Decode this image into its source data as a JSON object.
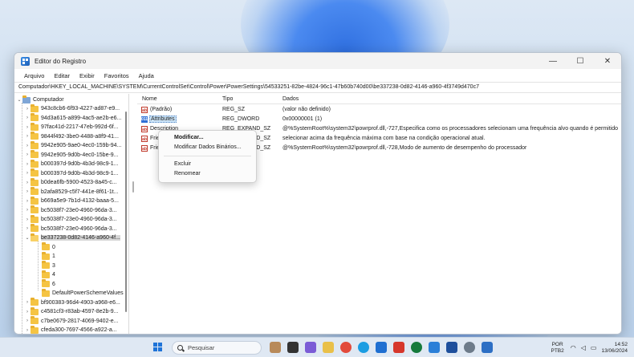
{
  "window": {
    "title": "Editor do Registro",
    "controls": {
      "minimize": "—",
      "maximize": "☐",
      "close": "✕"
    }
  },
  "menubar": [
    "Arquivo",
    "Editar",
    "Exibir",
    "Favoritos",
    "Ajuda"
  ],
  "address": "Computador\\HKEY_LOCAL_MACHINE\\SYSTEM\\CurrentControlSet\\Control\\Power\\PowerSettings\\54533251-82be-4824-96c1-47b60b740d00\\be337238-0d82-4146-a960-4f3749d470c7",
  "tree": {
    "root": "Computador",
    "items": [
      "943c8cb6-6f93-4227-ad87-e9...",
      "94d3a615-a899-4ac5-ae2b-e6...",
      "97fac41d-2217-47eb-992d-6f...",
      "9844f492-3be0-4488-a8f9-41...",
      "9942e905-9ae0-4ec0-159b-94...",
      "9942e905-9d0b-4ec0-15be-9...",
      "b000397d-9d0b-4b3d-98c9-1...",
      "b000397d-9d0b-4b3d-98c9-1...",
      "b0dea6fb-5900-4523-8a45-c...",
      "b2afa8529-c5f7-441e-8f61-1t...",
      "b669a5e9-7b1d-4132-baaa-5...",
      "bc5038f7-23e0-4960-96da-3...",
      "bc5038f7-23e0-4960-96da-3...",
      "bc5038f7-23e0-4960-96da-3...",
      "be337238-0d82-4146-a960-4f..."
    ],
    "children": [
      "0",
      "1",
      "3",
      "4",
      "6",
      "DefaultPowerSchemeValues"
    ],
    "after": [
      "bf900383-96d4-4903-a968-e6...",
      "c4581cf3-r83ab-4597-8e2b-9...",
      "c7be0679-2817-4069-9402-e...",
      "cfeda300-7697-4566-a922-a..."
    ]
  },
  "values": {
    "headers": {
      "name": "Nome",
      "type": "Tipo",
      "data": "Dados"
    },
    "rows": [
      {
        "icon": "ab",
        "name": "(Padrão)",
        "type": "REG_SZ",
        "data": "(valor não definido)"
      },
      {
        "icon": "011",
        "name": "Attributes",
        "type": "REG_DWORD",
        "data": "0x00000001 (1)"
      },
      {
        "icon": "ab",
        "name": "Description",
        "type": "REG_EXPAND_SZ",
        "data": "@%SystemRoot%\\system32\\powrprof.dll,-727,Especifica como os processadores selecionam uma frequência alvo quando é permitido"
      },
      {
        "icon": "ab",
        "name": "FriendlyName",
        "type": "REG_EXPAND_SZ",
        "data": "selecionar acima da frequência máxima com base na condição operacional atual."
      },
      {
        "icon": "ab",
        "name": "FriendlyName",
        "type": "REG_EXPAND_SZ",
        "data": "@%SystemRoot%\\system32\\powrprof.dll,-728,Modo de aumento de desempenho do processador"
      }
    ]
  },
  "context_menu": {
    "modify": "Modificar...",
    "modify_binary": "Modificar Dados Binários...",
    "delete": "Excluir",
    "rename": "Renomear"
  },
  "taskbar": {
    "search_placeholder": "Pesquisar",
    "language_line1": "POR",
    "language_line2": "PTB2",
    "time": "14:52",
    "date": "13/06/2024"
  }
}
